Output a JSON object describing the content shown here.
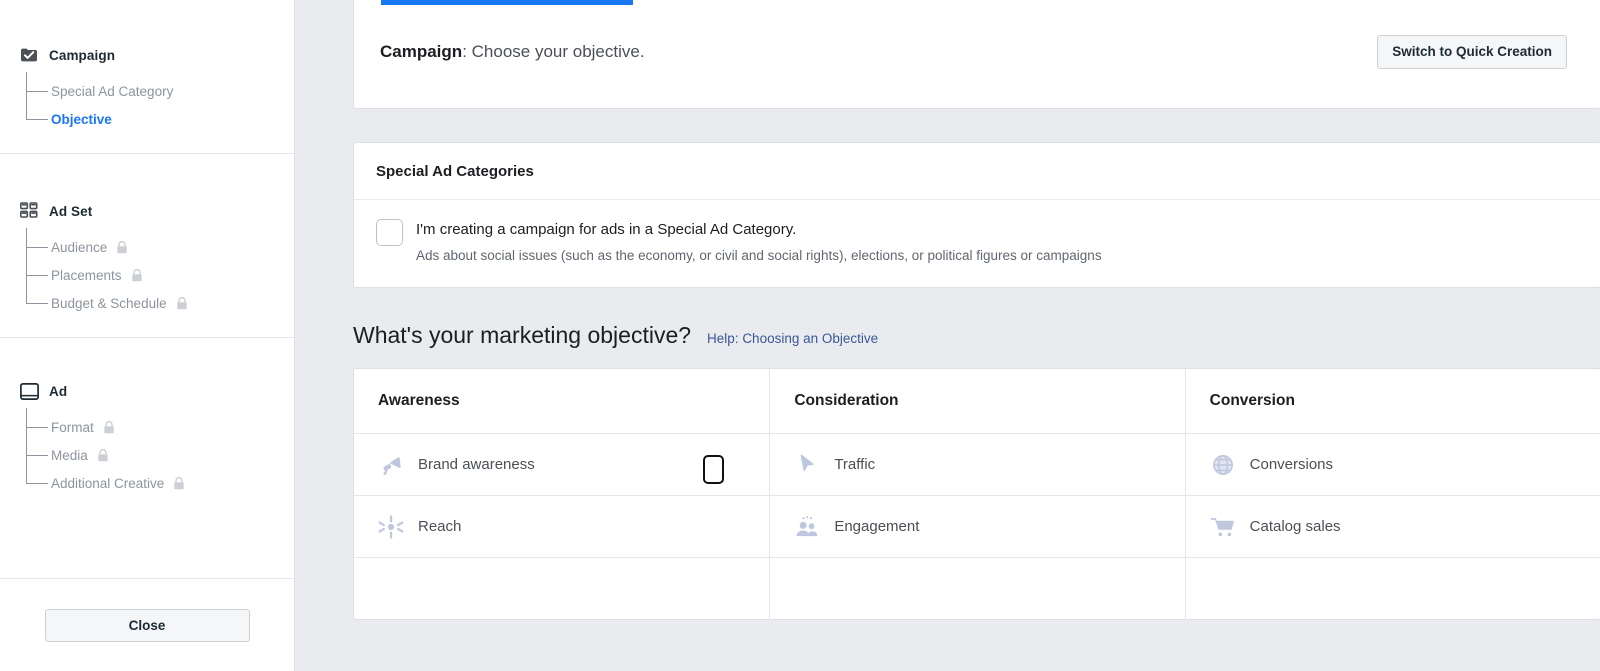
{
  "sidebar": {
    "sections": [
      {
        "icon": "campaign-checked-icon",
        "title": "Campaign",
        "children": [
          {
            "label": "Special Ad Category",
            "locked": false,
            "active": false
          },
          {
            "label": "Objective",
            "locked": false,
            "active": true
          }
        ]
      },
      {
        "icon": "ad-set-grid-icon",
        "title": "Ad Set",
        "children": [
          {
            "label": "Audience",
            "locked": true,
            "active": false
          },
          {
            "label": "Placements",
            "locked": true,
            "active": false
          },
          {
            "label": "Budget & Schedule",
            "locked": true,
            "active": false
          }
        ]
      },
      {
        "icon": "ad-window-icon",
        "title": "Ad",
        "children": [
          {
            "label": "Format",
            "locked": true,
            "active": false
          },
          {
            "label": "Media",
            "locked": true,
            "active": false
          },
          {
            "label": "Additional Creative",
            "locked": true,
            "active": false
          }
        ]
      }
    ],
    "close_label": "Close"
  },
  "header": {
    "title_bold": "Campaign",
    "title_rest": ": Choose your objective.",
    "quick_creation_label": "Switch to Quick Creation",
    "active_tab_accent": "#1877f2"
  },
  "special_ad_categories": {
    "title": "Special Ad Categories",
    "checkbox_checked": false,
    "checkbox_label": "I'm creating a campaign for ads in a Special Ad Category.",
    "description": "Ads about social issues (such as the economy, or civil and social rights), elections, or political figures or campaigns"
  },
  "objective": {
    "heading": "What's your marketing objective?",
    "help_link": "Help: Choosing an Objective",
    "columns": [
      "Awareness",
      "Consideration",
      "Conversion"
    ],
    "rows": [
      [
        {
          "icon": "megaphone-icon",
          "label": "Brand awareness"
        },
        {
          "icon": "cursor-arrow-icon",
          "label": "Traffic"
        },
        {
          "icon": "globe-icon",
          "label": "Conversions"
        }
      ],
      [
        {
          "icon": "reach-starburst-icon",
          "label": "Reach"
        },
        {
          "icon": "people-icon",
          "label": "Engagement"
        },
        {
          "icon": "shopping-cart-icon",
          "label": "Catalog sales"
        }
      ]
    ]
  },
  "colors": {
    "accent": "#1877f2",
    "link": "#385898",
    "page_background": "#e9ebee",
    "icon_tint": "#bec7de"
  }
}
